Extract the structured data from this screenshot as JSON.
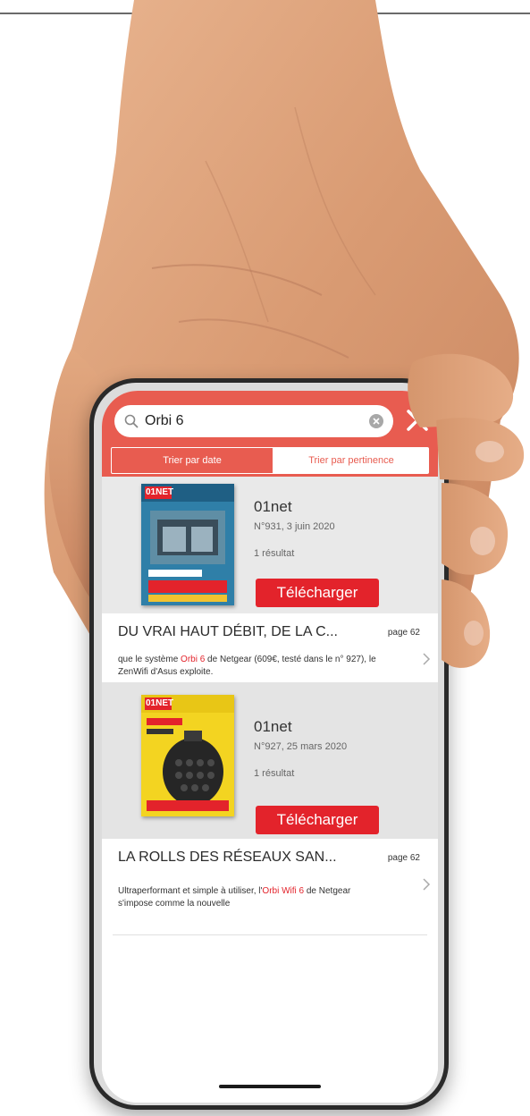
{
  "search": {
    "value": "Orbi 6"
  },
  "sort_tabs": {
    "date_label": "Trier par date",
    "relevance_label": "Trier par pertinence",
    "active": "date"
  },
  "results": [
    {
      "magazine": "01net",
      "issue": "N°931, 3 juin 2020",
      "count": "1 résultat",
      "download_label": "Télécharger",
      "cover_logo": "01NET",
      "article": {
        "title": "DU VRAI HAUT DÉBIT, DE LA C...",
        "page": "page 62",
        "snippet_before": "que le système ",
        "snippet_highlight": "Orbi 6",
        "snippet_after": " de Netgear (609€, testé dans le n° 927), le ZenWifi d'Asus exploite."
      }
    },
    {
      "magazine": "01net",
      "issue": "N°927, 25 mars 2020",
      "count": "1 résultat",
      "download_label": "Télécharger",
      "cover_logo": "01NET",
      "article": {
        "title": "LA ROLLS DES RÉSEAUX SAN...",
        "page": "page 62",
        "snippet_before": "Ultraperformant et simple à utiliser, l'",
        "snippet_highlight": "Orbi Wifi 6",
        "snippet_after": " de Netgear s'impose comme la nouvelle"
      }
    }
  ],
  "colors": {
    "header_red": "#e85c50",
    "button_red": "#e3232b",
    "highlight_red": "#e3232b"
  }
}
